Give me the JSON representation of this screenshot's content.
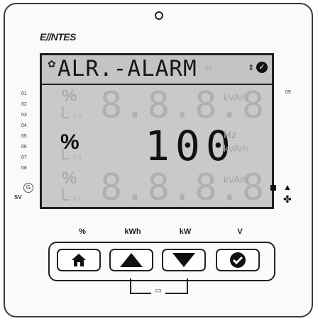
{
  "brand": "E//NTES",
  "display": {
    "top_text": "ALR.-ALARM",
    "row1": {
      "ghost_digits": "8.8.8.8",
      "ghost_unit": "kVArh"
    },
    "row2": {
      "unit_label": "%",
      "value": "100",
      "ghost_unit_top": "Hz",
      "ghost_unit": "kVArh"
    },
    "row3": {
      "ghost_digits": "8.8.8.8",
      "ghost_unit": "kVArh"
    }
  },
  "side_indicators": [
    "01",
    "02",
    "03",
    "04",
    "05",
    "06",
    "07",
    "08"
  ],
  "side_right": "09",
  "sv_label": "SV",
  "g_label": "G",
  "keys": {
    "labels": [
      "%",
      "kWh",
      "kW",
      "V"
    ]
  },
  "icons": {
    "home": "home-icon",
    "up": "arrow-up-icon",
    "down": "arrow-down-icon",
    "check": "check-icon",
    "bell": "bell-icon",
    "fan": "fan-icon",
    "gear": "gear-icon"
  }
}
